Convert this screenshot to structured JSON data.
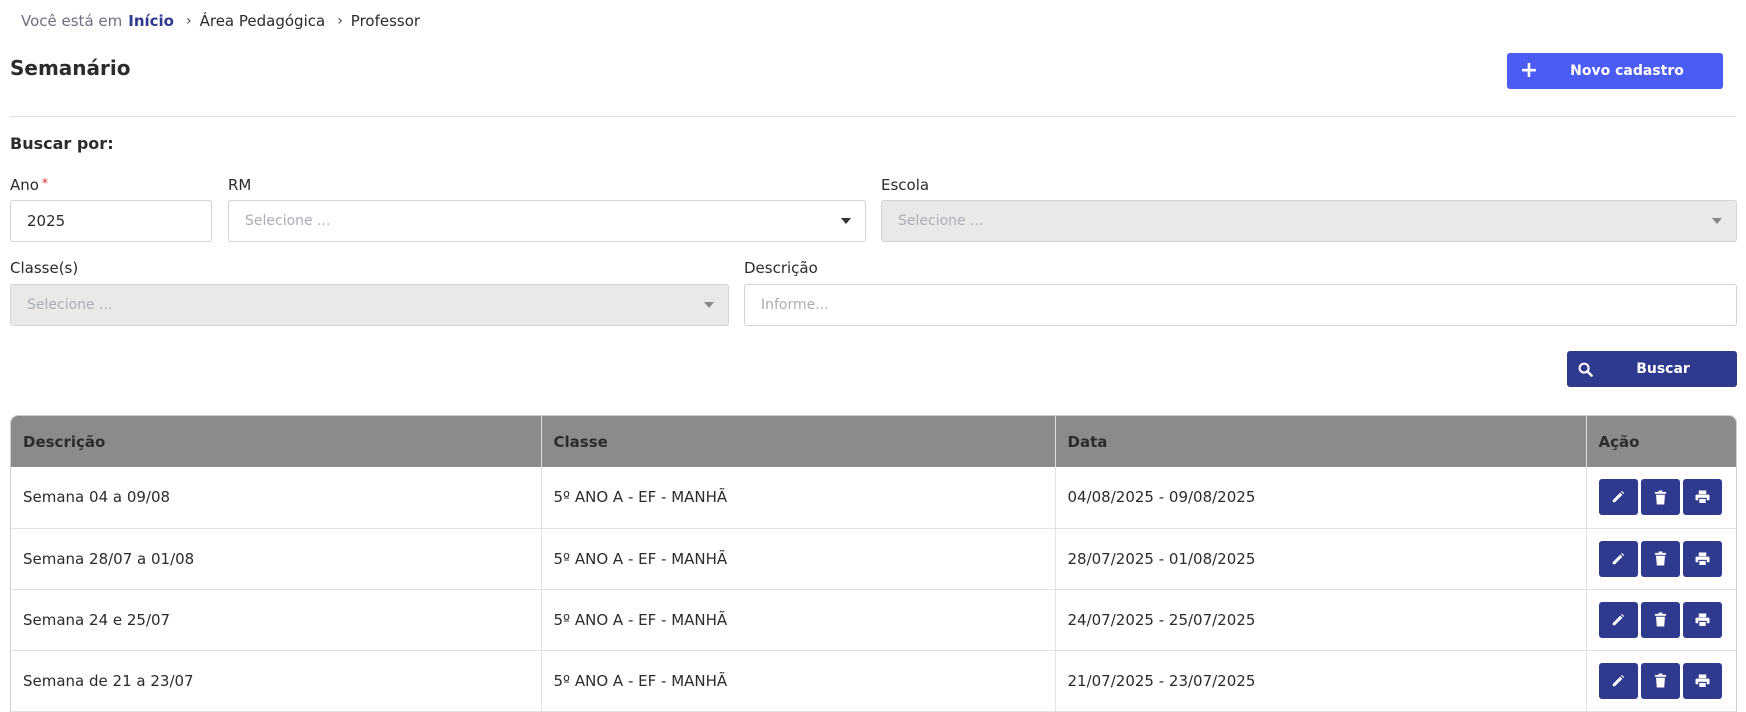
{
  "breadcrumb": {
    "prefix": "Você está em",
    "home": "Início",
    "items": [
      "Área Pedagógica",
      "Professor"
    ]
  },
  "page": {
    "title": "Semanário",
    "new_button": "Novo cadastro"
  },
  "filters": {
    "heading": "Buscar por:",
    "ano": {
      "label": "Ano",
      "value": "2025"
    },
    "rm": {
      "label": "RM",
      "placeholder": "Selecione ..."
    },
    "escola": {
      "label": "Escola",
      "placeholder": "Selecione ..."
    },
    "classes": {
      "label": "Classe(s)",
      "placeholder": "Selecione ..."
    },
    "descricao": {
      "label": "Descrição",
      "placeholder": "Informe..."
    },
    "search_button": "Buscar"
  },
  "table": {
    "headers": [
      "Descrição",
      "Classe",
      "Data",
      "Ação"
    ],
    "rows": [
      {
        "descricao": "Semana 04 a 09/08",
        "classe": "5º ANO A - EF - MANHÃ",
        "data": "04/08/2025 - 09/08/2025"
      },
      {
        "descricao": "Semana 28/07 a 01/08",
        "classe": "5º ANO A - EF - MANHÃ",
        "data": "28/07/2025 - 01/08/2025"
      },
      {
        "descricao": "Semana 24 e 25/07",
        "classe": "5º ANO A - EF - MANHÃ",
        "data": "24/07/2025 - 25/07/2025"
      },
      {
        "descricao": "Semana de 21 a 23/07",
        "classe": "5º ANO A - EF - MANHÃ",
        "data": "21/07/2025 - 23/07/2025"
      }
    ]
  },
  "colors": {
    "primary": "#4a5cf2",
    "dark_primary": "#2f3a8f",
    "table_header": "#8b8b8b"
  },
  "icons": [
    "plus-icon",
    "search-icon",
    "pencil-icon",
    "trash-icon",
    "printer-icon",
    "caret-down-icon"
  ]
}
